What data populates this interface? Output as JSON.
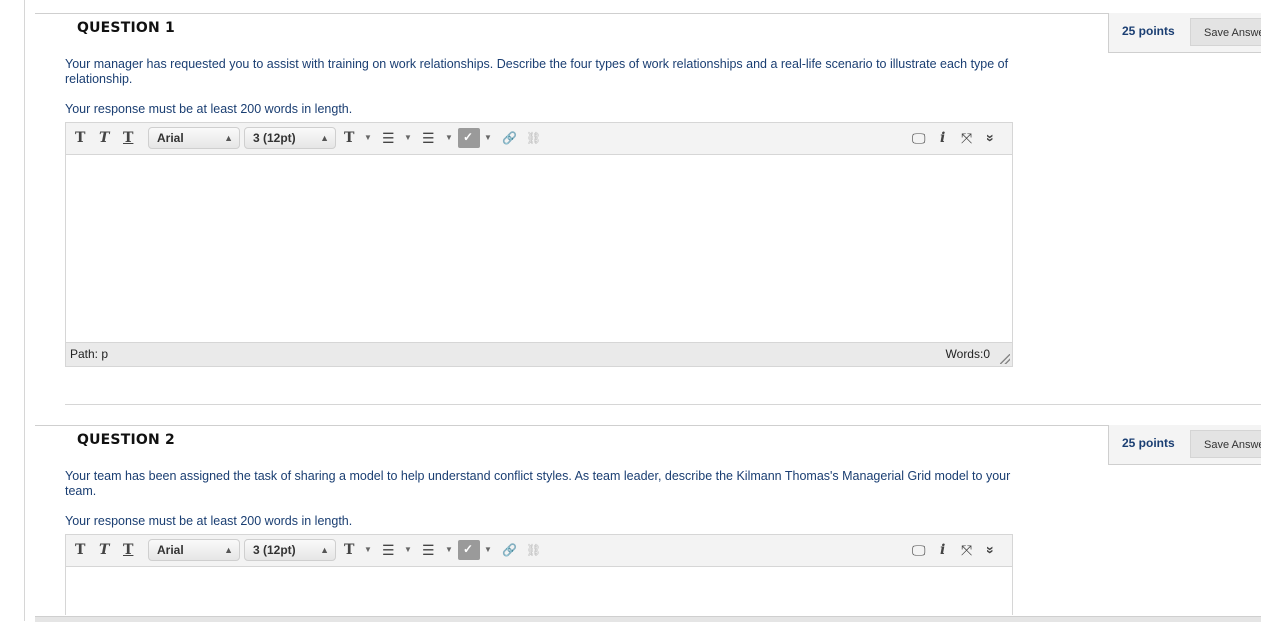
{
  "questions": [
    {
      "title": "QUESTION 1",
      "text": "Your manager has requested you to assist with training on work relationships. Describe the four types of work relationships and a real-life scenario to illustrate each type of relationship.",
      "requirement": "Your response must be at least 200 words in length.",
      "points": "25 points",
      "save_label": "Save Answer",
      "font": "Arial",
      "size": "3 (12pt)",
      "path": "Path: p",
      "words": "Words:0"
    },
    {
      "title": "QUESTION 2",
      "text": "Your team has been assigned the task of sharing a model to help understand conflict styles. As team leader, describe the Kilmann Thomas's Managerial Grid model to your team.",
      "requirement": "Your response must be at least 200 words in length.",
      "points": "25 points",
      "save_label": "Save Answer",
      "font": "Arial",
      "size": "3 (12pt)"
    }
  ],
  "toolbar": {
    "bold_glyph": "T",
    "italic_glyph": "T",
    "underline_glyph": "T",
    "text_color_glyph": "T",
    "bullet_glyph": "☰",
    "number_glyph": "☰",
    "spell_glyph": "✓",
    "link_glyph": "🔗",
    "unlink_glyph": "⛓",
    "preview_glyph": "🖵",
    "info_glyph": "i",
    "expand_glyph": "⤧",
    "more_glyph": "»"
  }
}
